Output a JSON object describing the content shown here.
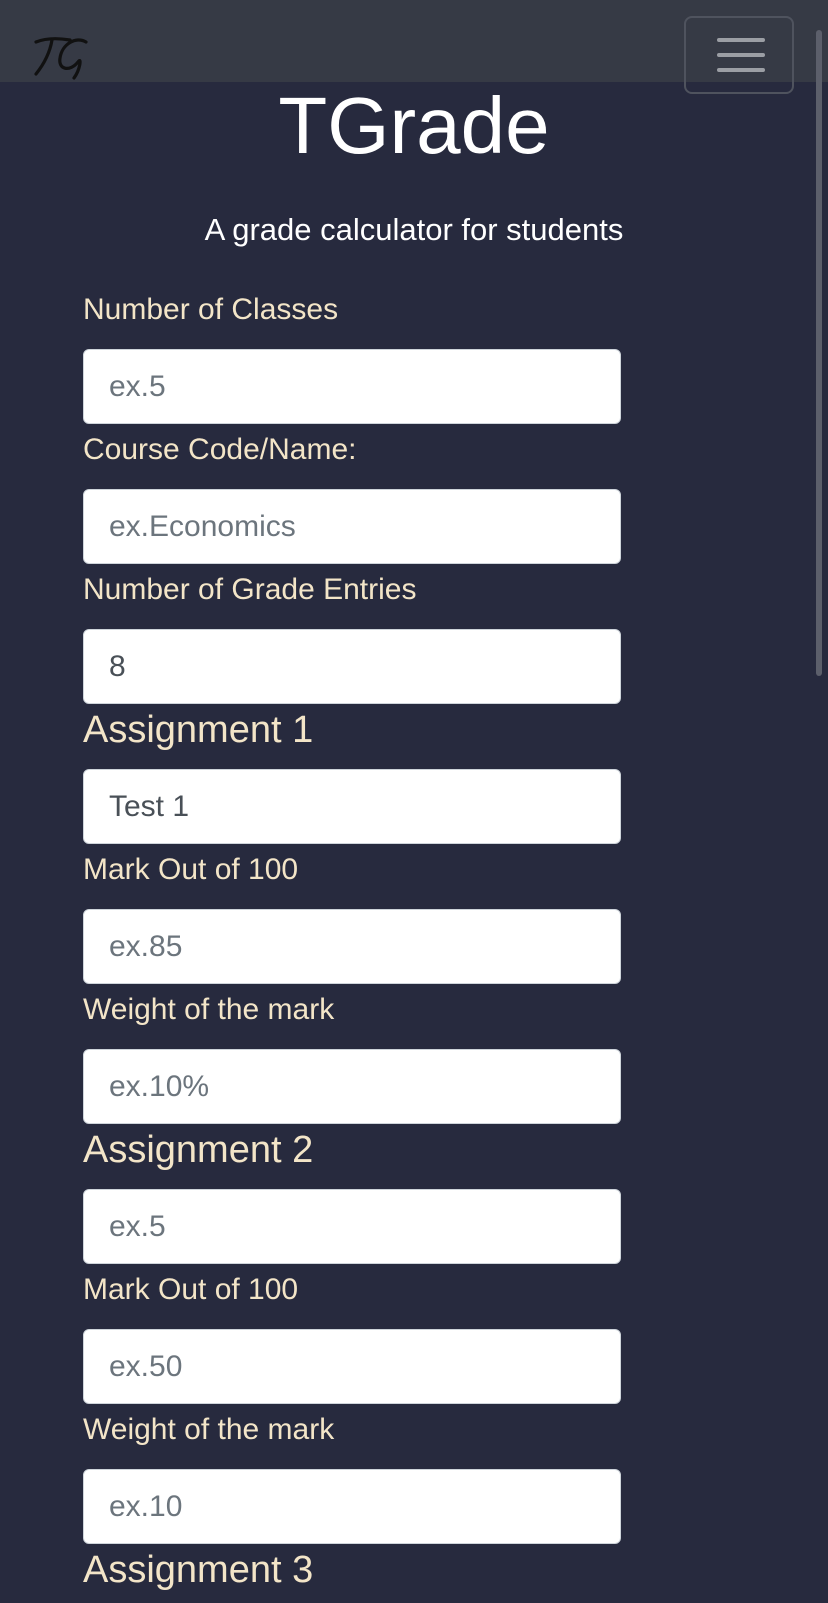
{
  "navbar": {
    "logo_text": "TG",
    "menu_icon": "hamburger-menu-icon"
  },
  "header": {
    "title": "TGrade",
    "subtitle": "A grade calculator for students"
  },
  "form": {
    "num_classes": {
      "label": "Number of Classes",
      "placeholder": "ex.5",
      "value": ""
    },
    "course_name": {
      "label": "Course Code/Name:",
      "placeholder": "ex.Economics",
      "value": ""
    },
    "num_entries": {
      "label": "Number of Grade Entries",
      "placeholder": "",
      "value": "8"
    },
    "assignments": [
      {
        "heading": "Assignment 1",
        "name_placeholder": "",
        "name_value": "Test 1",
        "mark_label": "Mark Out of 100",
        "mark_placeholder": "ex.85",
        "weight_label": "Weight of the mark",
        "weight_placeholder": "ex.10%"
      },
      {
        "heading": "Assignment 2",
        "name_placeholder": "ex.5",
        "name_value": "",
        "mark_label": "Mark Out of 100",
        "mark_placeholder": "ex.50",
        "weight_label": "Weight of the mark",
        "weight_placeholder": "ex.10"
      },
      {
        "heading": "Assignment 3"
      }
    ]
  }
}
